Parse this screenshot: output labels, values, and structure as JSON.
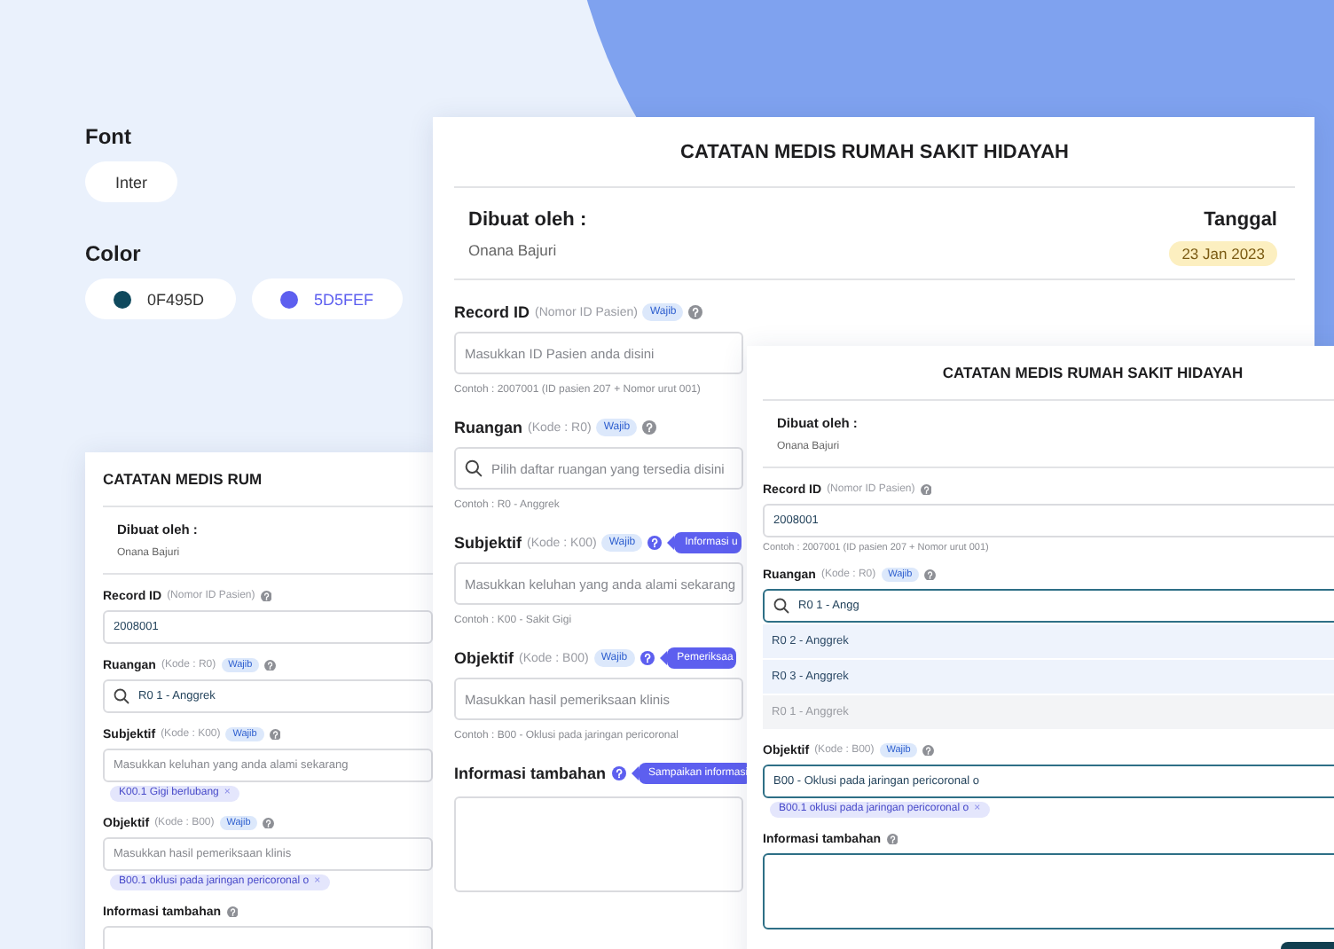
{
  "style_guide": {
    "font_heading": "Font",
    "font": "Inter",
    "color_heading": "Color",
    "colors": [
      {
        "label": "0F495D",
        "color": "#0f495d"
      },
      {
        "label": "5D5FEF",
        "color": "#5d5fef"
      }
    ]
  },
  "cards": [
    {
      "title": "CATATAN MEDIS RUM",
      "author_label": "Dibuat oleh :",
      "author": "Onana Bajuri",
      "fields": [
        {
          "kind": "input",
          "label": "Record ID",
          "code": "(Nomor ID Pasien)",
          "value": "2008001",
          "focused": false
        },
        {
          "kind": "search",
          "label": "Ruangan",
          "code": "(Kode : R0)",
          "badge": "Wajib",
          "value": "R0 1 - Anggrek",
          "focused": false
        },
        {
          "kind": "input",
          "label": "Subjektif",
          "code": "(Kode : K00)",
          "badge": "Wajib",
          "placeholder": "Masukkan keluhan yang anda alami sekarang",
          "focused": false,
          "chip": "K00.1 Gigi berlubang",
          "chip_remove": "×"
        },
        {
          "kind": "input",
          "label": "Objektif",
          "code": "(Kode : B00)",
          "badge": "Wajib",
          "placeholder": "Masukkan hasil pemeriksaan klinis",
          "focused": false,
          "chip": "B00.1 oklusi pada jaringan pericoronal o",
          "chip_remove": "×"
        },
        {
          "kind": "textarea",
          "label": "Informasi tambahan",
          "focused": false
        }
      ]
    },
    {
      "title": "CATATAN MEDIS RUMAH SAKIT HIDAYAH",
      "author_label": "Dibuat oleh :",
      "author": "Onana Bajuri",
      "date_label": "Tanggal",
      "date": "23 Jan 2023",
      "fields": [
        {
          "kind": "input",
          "label": "Record ID",
          "code": "(Nomor ID Pasien)",
          "badge": "Wajib",
          "placeholder": "Masukkan ID Pasien anda disini",
          "hint": "Contoh : 2007001 (ID pasien 207 + Nomor urut 001)",
          "focused": false
        },
        {
          "kind": "search",
          "label": "Ruangan",
          "code": "(Kode : R0)",
          "badge": "Wajib",
          "placeholder": "Pilih daftar ruangan yang tersedia disini",
          "hint": "Contoh : R0 - Anggrek",
          "focused": false
        },
        {
          "kind": "input",
          "label": "Subjektif",
          "code": "(Kode : K00)",
          "badge": "Wajib",
          "tooltip": "Informasi u",
          "placeholder": "Masukkan keluhan yang anda alami sekarang",
          "hint": "Contoh : K00 - Sakit Gigi",
          "focused": false
        },
        {
          "kind": "input",
          "label": "Objektif",
          "code": "(Kode : B00)",
          "badge": "Wajib",
          "tooltip": "Pemeriksaa",
          "placeholder": "Masukkan hasil pemeriksaan klinis",
          "hint": "Contoh : B00 - Oklusi pada jaringan pericoronal",
          "focused": false
        },
        {
          "kind": "textarea",
          "label": "Informasi tambahan",
          "tooltip": "Sampaikan informasi",
          "focused": false
        }
      ]
    },
    {
      "title": "CATATAN MEDIS RUMAH SAKIT HIDAYAH",
      "author_label": "Dibuat oleh :",
      "author": "Onana Bajuri",
      "submit_button": true,
      "fields": [
        {
          "kind": "input",
          "label": "Record ID",
          "code": "(Nomor ID Pasien)",
          "value": "2008001",
          "hint": "Contoh : 2007001 (ID pasien 207 + Nomor urut 001)",
          "focused": false
        },
        {
          "kind": "search",
          "label": "Ruangan",
          "code": "(Kode : R0)",
          "badge": "Wajib",
          "value": "R0 1 - Angg",
          "focused": true,
          "options": [
            {
              "label": "R0 2 - Anggrek",
              "disabled": false
            },
            {
              "label": "R0 3 - Anggrek",
              "disabled": false
            },
            {
              "label": "R0 1 - Anggrek",
              "disabled": true
            }
          ]
        },
        {
          "kind": "input",
          "label": "Objektif",
          "code": "(Kode : B00)",
          "badge": "Wajib",
          "value": "B00 - Oklusi pada jaringan pericoronal o",
          "focused": true,
          "chip": "B00.1 oklusi pada jaringan pericoronal o",
          "chip_remove": "×"
        },
        {
          "kind": "textarea",
          "label": "Informasi tambahan",
          "focused": true
        }
      ]
    }
  ]
}
